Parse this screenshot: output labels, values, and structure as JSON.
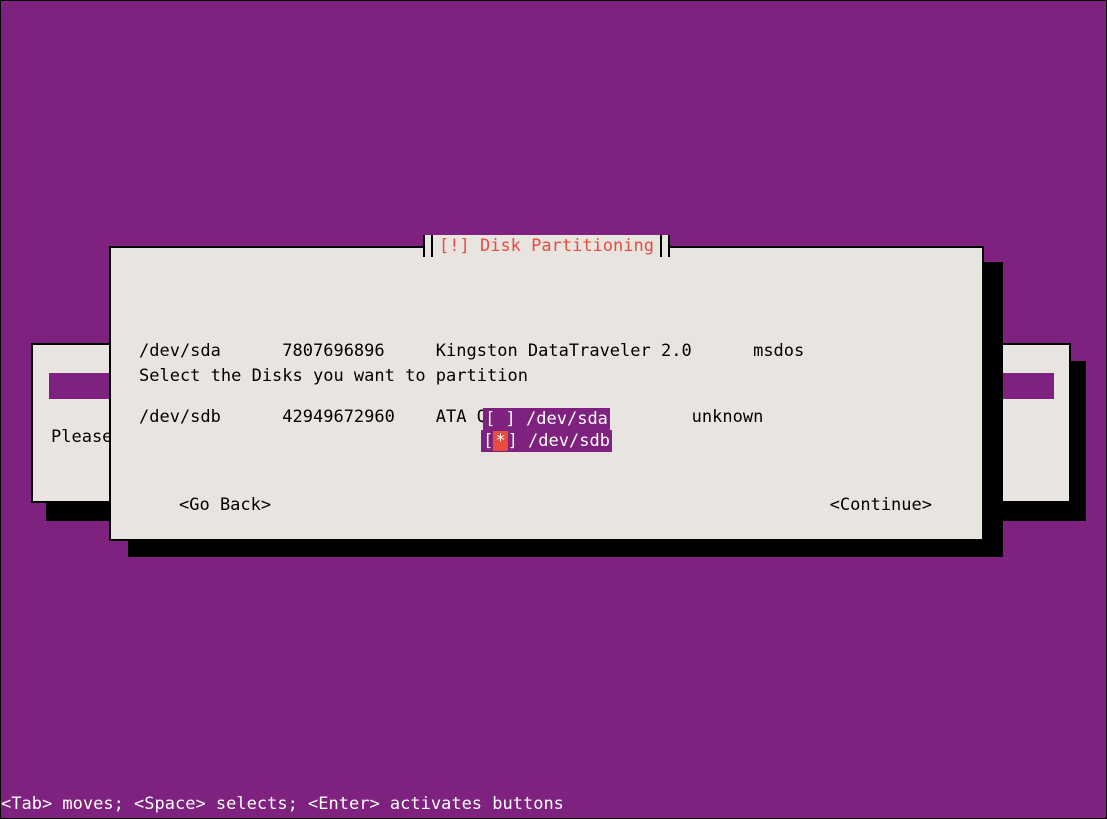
{
  "dialog": {
    "title": "[!] Disk Partitioning",
    "prompt": "Select the Disks you want to partition",
    "go_back": "<Go Back>",
    "continue": "<Continue>"
  },
  "back_dialog": {
    "please": "Please"
  },
  "disks": [
    {
      "dev": "/dev/sda",
      "size": "7807696896",
      "model": "Kingston DataTraveler 2.0",
      "ptable": "msdos",
      "selected": false
    },
    {
      "dev": "/dev/sdb",
      "size": "42949672960",
      "model": "ATA QEMU HARDDISK",
      "ptable": "unknown",
      "selected": true
    }
  ],
  "render": {
    "disk_row_0": "/dev/sda      7807696896     Kingston DataTraveler 2.0      msdos",
    "disk_row_1": "/dev/sdb      42949672960    ATA QEMU HARDDISK        unknown",
    "ck0_pre": "[ ]",
    "ck0_dev": " /dev/sda",
    "ck1_pre_l": "[",
    "ck1_star": "*",
    "ck1_pre_r": "]",
    "ck1_dev": " /dev/sdb"
  },
  "footer": "<Tab> moves; <Space> selects; <Enter> activates buttons"
}
